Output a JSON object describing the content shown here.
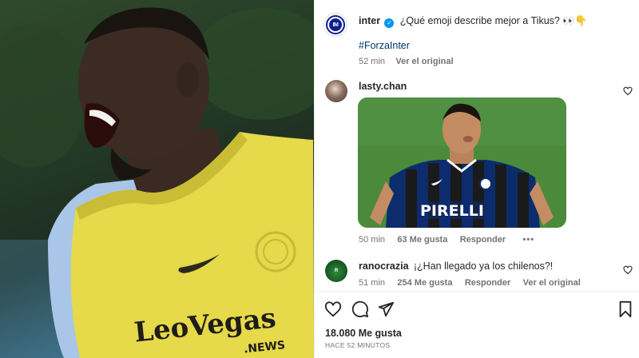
{
  "post": {
    "author": "inter",
    "caption": "¿Qué emoji describe mejor a Tikus? 👀👇",
    "hashtag": "#ForzaInter",
    "time": "52 min",
    "see_original": "Ver el original"
  },
  "comments": [
    {
      "user": "lasty.chan",
      "time": "50 min",
      "likes": "63 Me gusta",
      "reply": "Responder",
      "more": "•••"
    },
    {
      "user": "ranocrazia",
      "text": "¡¿Han llegado ya los chilenos?!",
      "time": "51 min",
      "likes": "254 Me gusta",
      "reply": "Responder",
      "see_original": "Ver el original"
    }
  ],
  "footer": {
    "likes": "18.080 Me gusta",
    "posted": "HACE 52 MINUTOS"
  },
  "photo_text": {
    "bib_brand": "LeoVegas",
    "bib_sub": ".NEWS"
  },
  "gif_text": {
    "sponsor": "PIRELLI"
  },
  "icons": {
    "verified": "verified-badge-icon",
    "like": "heart-icon",
    "comment": "comment-icon",
    "share": "send-icon",
    "save": "bookmark-icon"
  },
  "colors": {
    "verified": "#0095f6",
    "hashtag": "#00376b",
    "muted": "#737373",
    "bib_yellow": "#e6d94a"
  }
}
